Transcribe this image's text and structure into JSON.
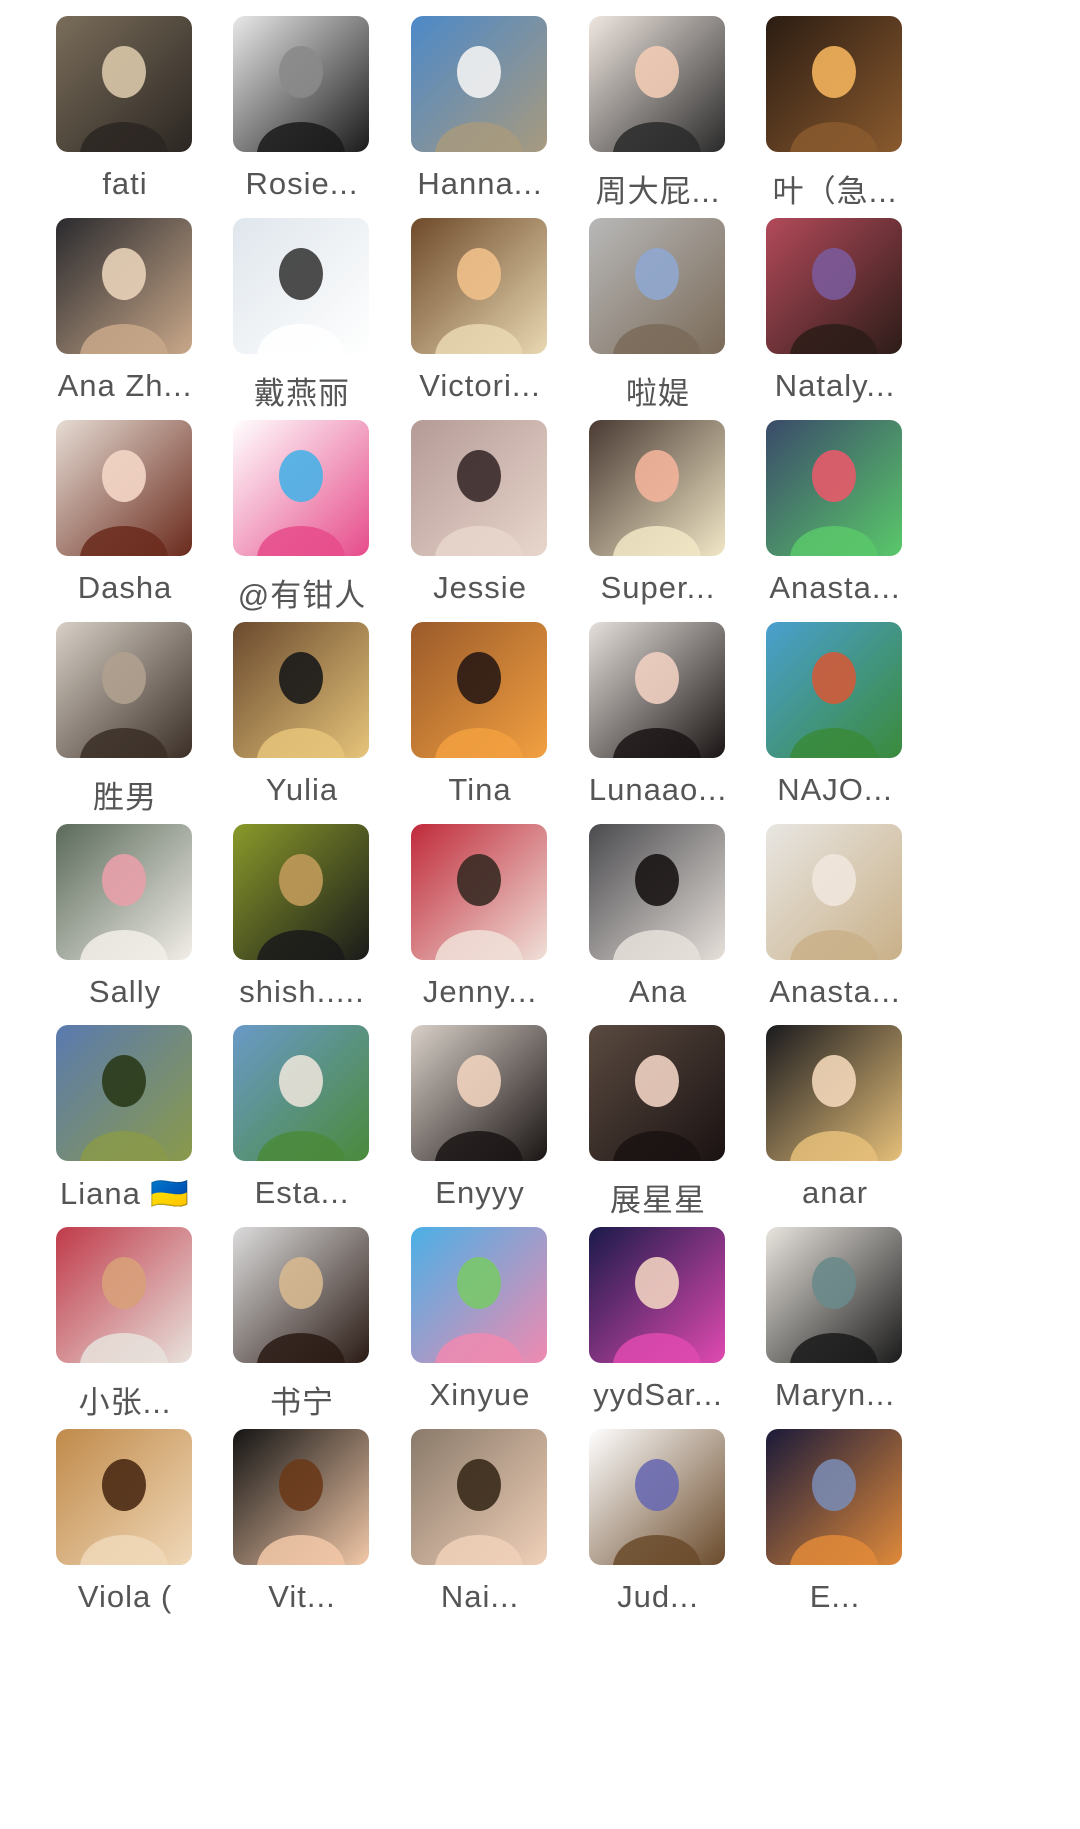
{
  "contacts": [
    {
      "name": "fati",
      "c1": "#7a6d5a",
      "c2": "#2b2622",
      "c3": "#d9c7a8"
    },
    {
      "name": "Rosie...",
      "c1": "#e8e8e8",
      "c2": "#1a1a1a",
      "c3": "#8a8a8a"
    },
    {
      "name": "Hanna...",
      "c1": "#4c89c9",
      "c2": "#a89a7e",
      "c3": "#f2f2f2"
    },
    {
      "name": "周大屁...",
      "c1": "#efe6e0",
      "c2": "#2a2a2a",
      "c3": "#f1cbb4"
    },
    {
      "name": "叶（急...",
      "c1": "#2b1c12",
      "c2": "#8a5a2e",
      "c3": "#f2b35c"
    },
    {
      "name": "Ana Zh...",
      "c1": "#2a2a2e",
      "c2": "#c9a88a",
      "c3": "#e8d2b8"
    },
    {
      "name": "戴燕丽",
      "c1": "#dfe6ec",
      "c2": "#ffffff",
      "c3": "#3a3a3a"
    },
    {
      "name": "Victori...",
      "c1": "#6e4a2a",
      "c2": "#e9d8b2",
      "c3": "#f0c08a"
    },
    {
      "name": "啦媞",
      "c1": "#b8b8b8",
      "c2": "#7a6a58",
      "c3": "#8fa7cf"
    },
    {
      "name": "Nataly...",
      "c1": "#b34a5a",
      "c2": "#2c1c18",
      "c3": "#7b5a9a"
    },
    {
      "name": "Dasha",
      "c1": "#e6dcd4",
      "c2": "#6a2a1c",
      "c3": "#f4d6c6"
    },
    {
      "name": "@有钳人",
      "c1": "#ffffff",
      "c2": "#e64b8a",
      "c3": "#4ab0e6"
    },
    {
      "name": "Jessie",
      "c1": "#b59a96",
      "c2": "#e8d6cc",
      "c3": "#3a2a2a"
    },
    {
      "name": "Super...",
      "c1": "#4a3a34",
      "c2": "#f1e7c6",
      "c3": "#f2b29a"
    },
    {
      "name": "Anasta...",
      "c1": "#3a4a6a",
      "c2": "#5ac86a",
      "c3": "#e65a6a"
    },
    {
      "name": "胜男",
      "c1": "#d8d0c6",
      "c2": "#3a2e26",
      "c3": "#b0a08e"
    },
    {
      "name": "Yulia",
      "c1": "#6a4a2e",
      "c2": "#e6c47a",
      "c3": "#1a1a1a"
    },
    {
      "name": "Tina",
      "c1": "#9a5a2a",
      "c2": "#f2a040",
      "c3": "#2a1a14"
    },
    {
      "name": "Lunaao...",
      "c1": "#e6e0dc",
      "c2": "#1a1414",
      "c3": "#f0cfc0"
    },
    {
      "name": "NAJO...",
      "c1": "#4aa0d0",
      "c2": "#3a8a3a",
      "c3": "#d05a3a"
    },
    {
      "name": "Sally",
      "c1": "#5a6a5a",
      "c2": "#f2eee8",
      "c3": "#e8a0a8"
    },
    {
      "name": "shish.....",
      "c1": "#8a9a2a",
      "c2": "#1a1a1a",
      "c3": "#c09a5a"
    },
    {
      "name": "Jenny...",
      "c1": "#c02a3a",
      "c2": "#f0e0d8",
      "c3": "#3a2a24"
    },
    {
      "name": "Ana",
      "c1": "#4a4a4e",
      "c2": "#e6e0da",
      "c3": "#1a1414"
    },
    {
      "name": "Anasta...",
      "c1": "#e8e6e2",
      "c2": "#c9b088",
      "c3": "#f0e6dc"
    },
    {
      "name": "Liana 🇺🇦",
      "c1": "#5a7ab0",
      "c2": "#8a9a4a",
      "c3": "#2a3a1a"
    },
    {
      "name": "Esta...",
      "c1": "#6a9ac8",
      "c2": "#4a8a3a",
      "c3": "#e8e2d8"
    },
    {
      "name": "Enyyy",
      "c1": "#d8d0c8",
      "c2": "#1a1414",
      "c3": "#f0d2be"
    },
    {
      "name": "展星星",
      "c1": "#5a4a40",
      "c2": "#1a1212",
      "c3": "#f0d2c2"
    },
    {
      "name": "anar",
      "c1": "#1a1a1e",
      "c2": "#e6c07a",
      "c3": "#f2d6b8"
    },
    {
      "name": "小张...",
      "c1": "#c03a4a",
      "c2": "#e8e2dc",
      "c3": "#d8a07a"
    },
    {
      "name": "书宁",
      "c1": "#dcdcdc",
      "c2": "#2a1a14",
      "c3": "#d6b890"
    },
    {
      "name": "Xinyue",
      "c1": "#4ab0e6",
      "c2": "#f08ab0",
      "c3": "#7ac86a"
    },
    {
      "name": "yydSar...",
      "c1": "#1a1a4a",
      "c2": "#e04ab0",
      "c3": "#f0d0c0"
    },
    {
      "name": "Maryn...",
      "c1": "#e8e4de",
      "c2": "#1a1a1a",
      "c3": "#6a8a8a"
    },
    {
      "name": "Viola (",
      "c1": "#c08a4a",
      "c2": "#f0d8b8",
      "c3": "#4a2a14"
    },
    {
      "name": "Vit...",
      "c1": "#141414",
      "c2": "#f2c8a8",
      "c3": "#6a3a1a"
    },
    {
      "name": "Nai...",
      "c1": "#8a7a6a",
      "c2": "#f0d0b8",
      "c3": "#3a2a1a"
    },
    {
      "name": "Jud...",
      "c1": "#ffffff",
      "c2": "#6a4a2a",
      "c3": "#6a6ab0"
    },
    {
      "name": "E...",
      "c1": "#1a1a3a",
      "c2": "#e08a3a",
      "c3": "#7a8ab0"
    }
  ]
}
